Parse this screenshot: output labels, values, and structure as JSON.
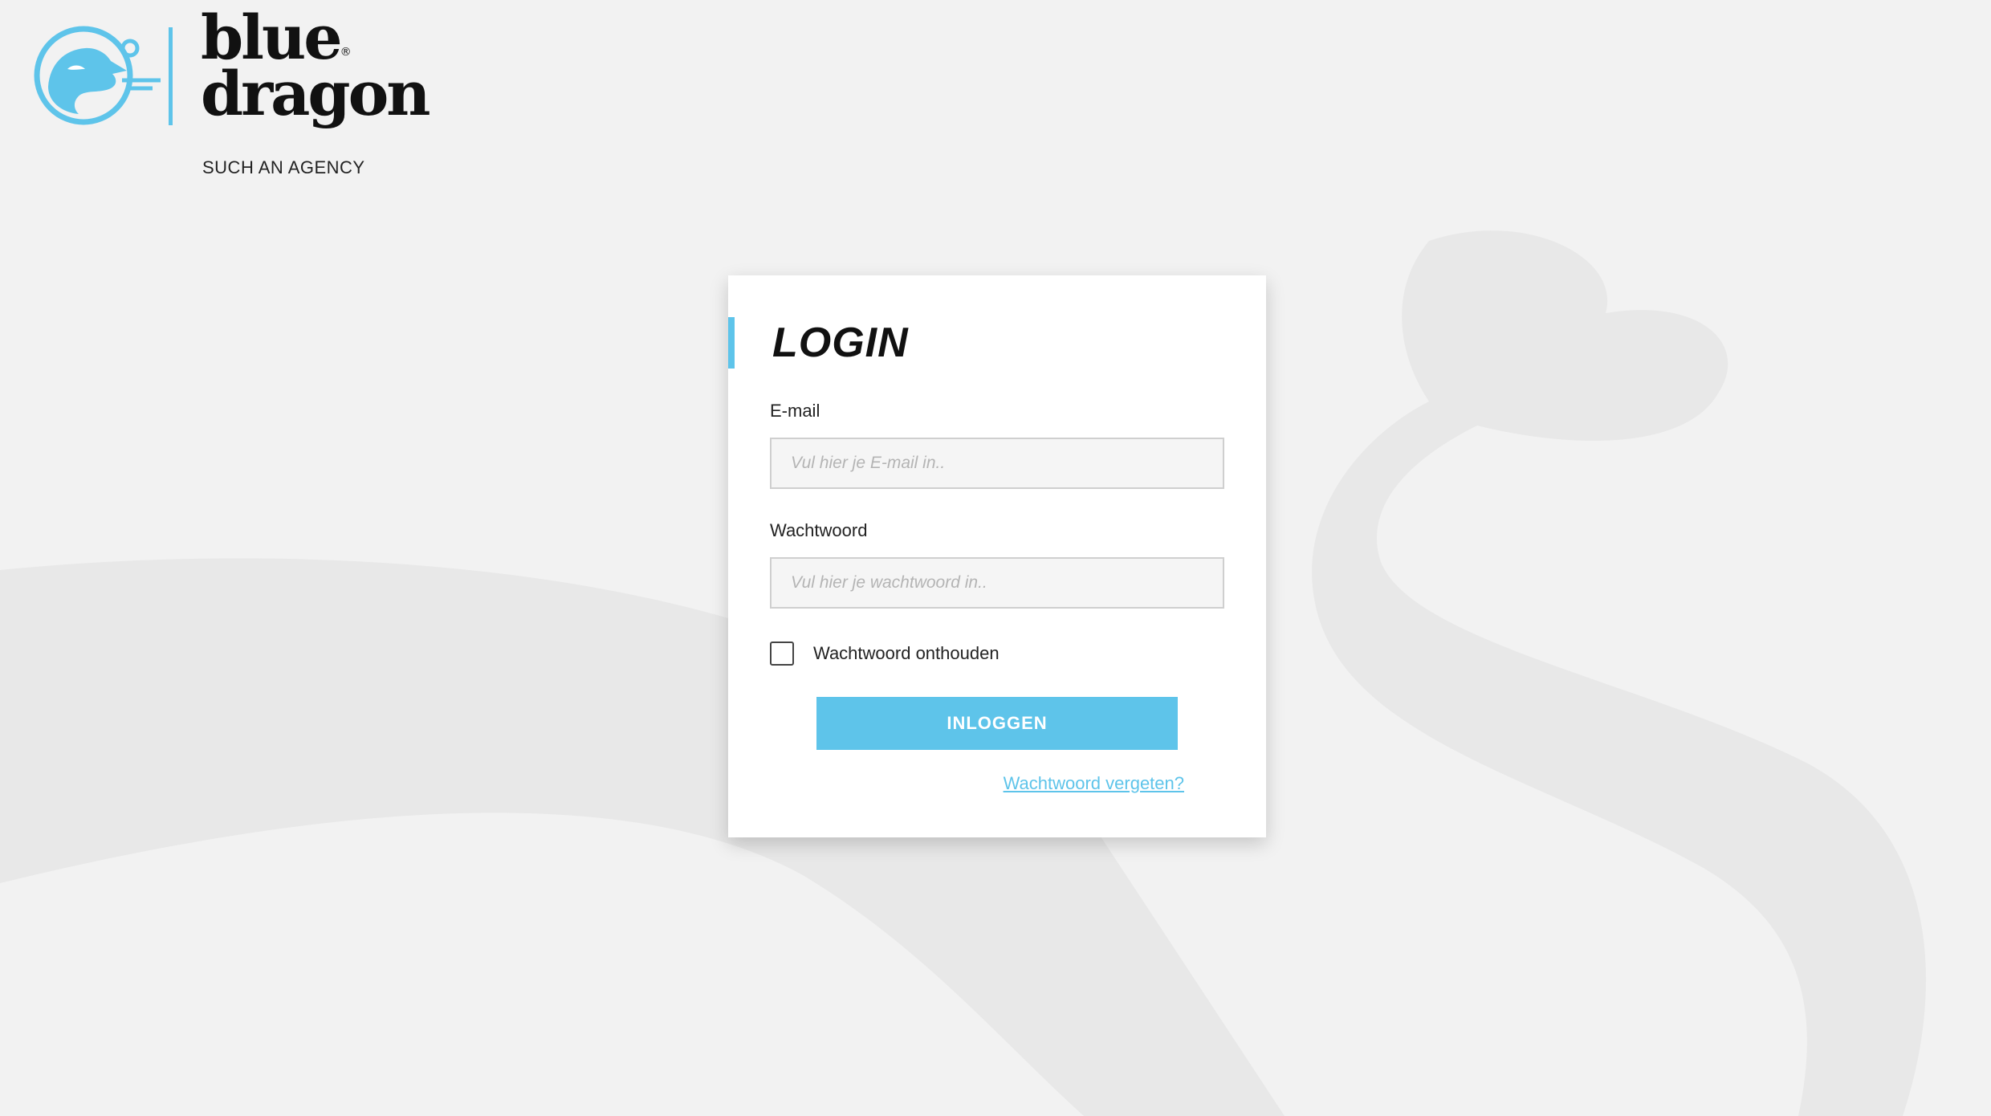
{
  "brand": {
    "word_line1": "blue",
    "word_line2": "dragon",
    "registered_mark": "®",
    "tagline": "SUCH AN AGENCY",
    "icon": "dragon-logo-icon",
    "accent_color": "#5ec4ea"
  },
  "login": {
    "title": "LOGIN",
    "email_label": "E-mail",
    "email_placeholder": "Vul hier je E-mail in..",
    "email_value": "",
    "password_label": "Wachtwoord",
    "password_placeholder": "Vul hier je wachtwoord in..",
    "password_value": "",
    "remember_label": "Wachtwoord onthouden",
    "remember_checked": false,
    "submit_label": "INLOGGEN",
    "forgot_label": "Wachtwoord vergeten?"
  },
  "colors": {
    "background": "#f2f2f2",
    "background_shape": "#e8e8e8",
    "card": "#ffffff",
    "accent": "#5ec4ea"
  }
}
